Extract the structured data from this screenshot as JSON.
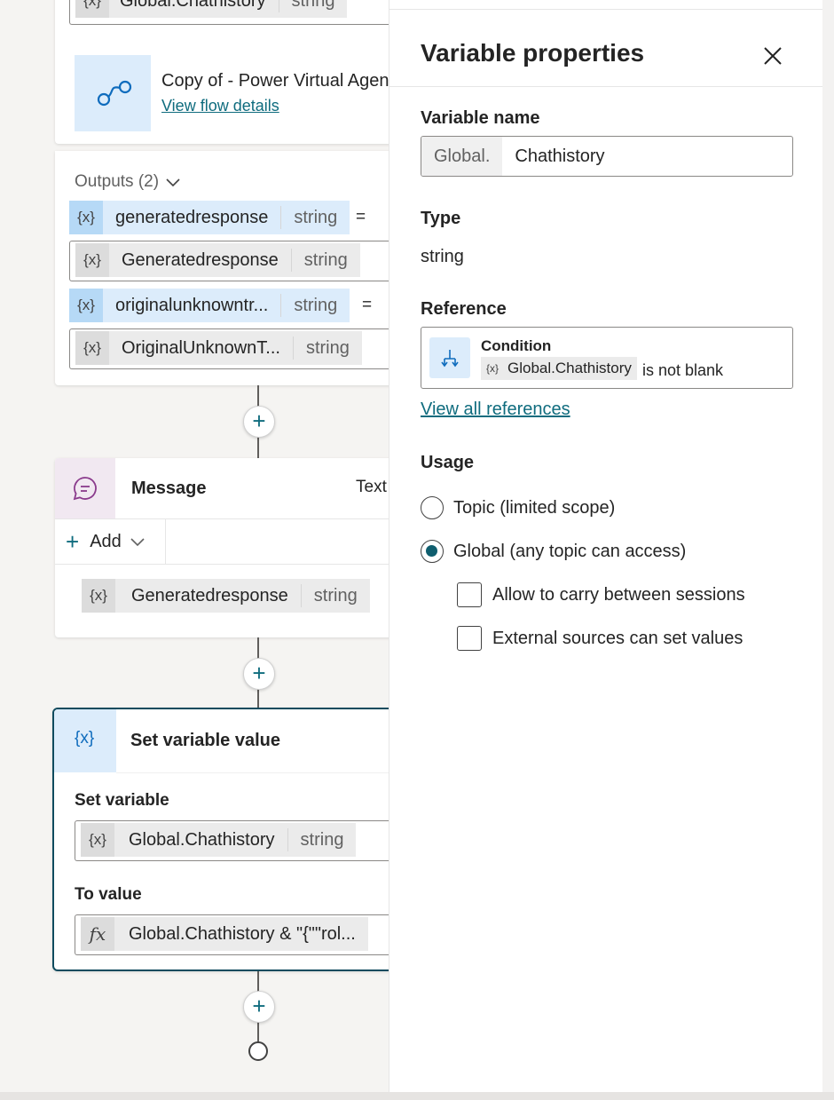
{
  "canvas": {
    "top_chip": {
      "name": "Global.Chathistory",
      "type": "string"
    },
    "flow": {
      "title": "Copy of - Power Virtual Agen",
      "link": "View flow details"
    },
    "outputs": {
      "label": "Outputs (2)",
      "rows": [
        {
          "name": "generatedresponse",
          "type": "string",
          "eq": "="
        },
        {
          "name": "Generatedresponse",
          "type": "string"
        },
        {
          "name": "originalunknowntr...",
          "type": "string",
          "eq": "="
        },
        {
          "name": "OriginalUnknownT...",
          "type": "string"
        }
      ]
    },
    "message": {
      "title": "Message",
      "mode": "Text",
      "add_label": "Add",
      "chip": {
        "name": "Generatedresponse",
        "type": "string"
      }
    },
    "set_variable": {
      "title": "Set variable value",
      "set_label": "Set variable",
      "var_chip": {
        "name": "Global.Chathistory",
        "type": "string"
      },
      "to_label": "To value",
      "value_chip": "Global.Chathistory & \"{\"\"rol..."
    },
    "var_icon": "{x}",
    "fx_icon": "fx"
  },
  "panel": {
    "title": "Variable properties",
    "variable_name_label": "Variable name",
    "prefix": "Global.",
    "name_value": "Chathistory",
    "type_label": "Type",
    "type_value": "string",
    "reference_label": "Reference",
    "reference": {
      "title": "Condition",
      "var": "Global.Chathistory",
      "suffix": "is not blank",
      "icon": "{x}"
    },
    "view_all": "View all references",
    "usage_label": "Usage",
    "options": [
      {
        "label": "Topic (limited scope)",
        "selected": false
      },
      {
        "label": "Global (any topic can access)",
        "selected": true
      }
    ],
    "checkboxes": [
      {
        "label": "Allow to carry between sessions",
        "checked": false
      },
      {
        "label": "External sources can set values",
        "checked": false
      }
    ]
  },
  "colors": {
    "accent": "#0f6c7e",
    "link": "#0f6c7e",
    "radio_fill": "#0f5e6e",
    "highlight": "#dcecfb"
  }
}
